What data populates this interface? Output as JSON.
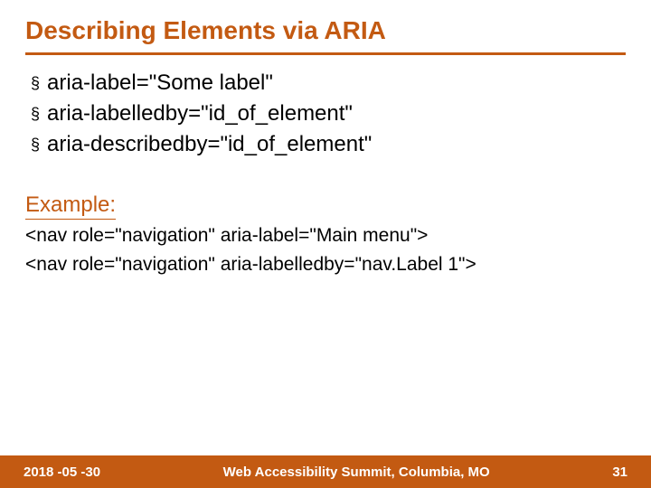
{
  "title": "Describing Elements via ARIA",
  "bullets": [
    "aria-label=\"Some label\"",
    "aria-labelledby=\"id_of_element\"",
    "aria-describedby=\"id_of_element\""
  ],
  "example_heading": "Example:",
  "code_lines": [
    "<nav role=\"navigation\" aria-label=\"Main menu\">",
    "<nav role=\"navigation\" aria-labelledby=\"nav.Label 1\">"
  ],
  "footer": {
    "date": "2018 -05 -30",
    "center": "Web Accessibility Summit, Columbia, MO",
    "page": "31"
  }
}
